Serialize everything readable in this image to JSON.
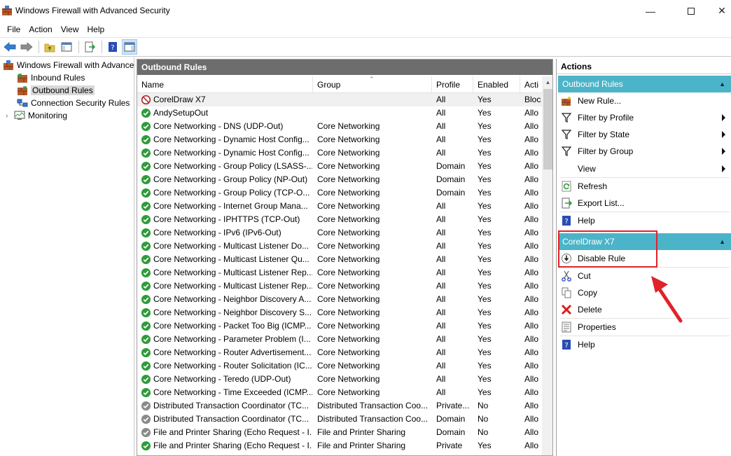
{
  "window": {
    "title": "Windows Firewall with Advanced Security"
  },
  "menubar": [
    "File",
    "Action",
    "View",
    "Help"
  ],
  "tree": [
    {
      "label": "Windows Firewall with Advance",
      "level": 0,
      "selected": false
    },
    {
      "label": "Inbound Rules",
      "level": 1,
      "selected": false
    },
    {
      "label": "Outbound Rules",
      "level": 1,
      "selected": true
    },
    {
      "label": "Connection Security Rules",
      "level": 1,
      "selected": false
    },
    {
      "label": "Monitoring",
      "level": 1,
      "selected": false
    }
  ],
  "center": {
    "title": "Outbound Rules",
    "columns": [
      "Name",
      "Group",
      "Profile",
      "Enabled",
      "Acti"
    ],
    "rows": [
      {
        "name": "CorelDraw X7",
        "group": "",
        "profile": "All",
        "enabled": "Yes",
        "action": "Bloc",
        "status": "block",
        "selected": true
      },
      {
        "name": "AndySetupOut",
        "group": "",
        "profile": "All",
        "enabled": "Yes",
        "action": "Allo",
        "status": "allow"
      },
      {
        "name": "Core Networking - DNS (UDP-Out)",
        "group": "Core Networking",
        "profile": "All",
        "enabled": "Yes",
        "action": "Allo",
        "status": "allow"
      },
      {
        "name": "Core Networking - Dynamic Host Config...",
        "group": "Core Networking",
        "profile": "All",
        "enabled": "Yes",
        "action": "Allo",
        "status": "allow"
      },
      {
        "name": "Core Networking - Dynamic Host Config...",
        "group": "Core Networking",
        "profile": "All",
        "enabled": "Yes",
        "action": "Allo",
        "status": "allow"
      },
      {
        "name": "Core Networking - Group Policy (LSASS-...",
        "group": "Core Networking",
        "profile": "Domain",
        "enabled": "Yes",
        "action": "Allo",
        "status": "allow"
      },
      {
        "name": "Core Networking - Group Policy (NP-Out)",
        "group": "Core Networking",
        "profile": "Domain",
        "enabled": "Yes",
        "action": "Allo",
        "status": "allow"
      },
      {
        "name": "Core Networking - Group Policy (TCP-O...",
        "group": "Core Networking",
        "profile": "Domain",
        "enabled": "Yes",
        "action": "Allo",
        "status": "allow"
      },
      {
        "name": "Core Networking - Internet Group Mana...",
        "group": "Core Networking",
        "profile": "All",
        "enabled": "Yes",
        "action": "Allo",
        "status": "allow"
      },
      {
        "name": "Core Networking - IPHTTPS (TCP-Out)",
        "group": "Core Networking",
        "profile": "All",
        "enabled": "Yes",
        "action": "Allo",
        "status": "allow"
      },
      {
        "name": "Core Networking - IPv6 (IPv6-Out)",
        "group": "Core Networking",
        "profile": "All",
        "enabled": "Yes",
        "action": "Allo",
        "status": "allow"
      },
      {
        "name": "Core Networking - Multicast Listener Do...",
        "group": "Core Networking",
        "profile": "All",
        "enabled": "Yes",
        "action": "Allo",
        "status": "allow"
      },
      {
        "name": "Core Networking - Multicast Listener Qu...",
        "group": "Core Networking",
        "profile": "All",
        "enabled": "Yes",
        "action": "Allo",
        "status": "allow"
      },
      {
        "name": "Core Networking - Multicast Listener Rep...",
        "group": "Core Networking",
        "profile": "All",
        "enabled": "Yes",
        "action": "Allo",
        "status": "allow"
      },
      {
        "name": "Core Networking - Multicast Listener Rep...",
        "group": "Core Networking",
        "profile": "All",
        "enabled": "Yes",
        "action": "Allo",
        "status": "allow"
      },
      {
        "name": "Core Networking - Neighbor Discovery A...",
        "group": "Core Networking",
        "profile": "All",
        "enabled": "Yes",
        "action": "Allo",
        "status": "allow"
      },
      {
        "name": "Core Networking - Neighbor Discovery S...",
        "group": "Core Networking",
        "profile": "All",
        "enabled": "Yes",
        "action": "Allo",
        "status": "allow"
      },
      {
        "name": "Core Networking - Packet Too Big (ICMP...",
        "group": "Core Networking",
        "profile": "All",
        "enabled": "Yes",
        "action": "Allo",
        "status": "allow"
      },
      {
        "name": "Core Networking - Parameter Problem (I...",
        "group": "Core Networking",
        "profile": "All",
        "enabled": "Yes",
        "action": "Allo",
        "status": "allow"
      },
      {
        "name": "Core Networking - Router Advertisement...",
        "group": "Core Networking",
        "profile": "All",
        "enabled": "Yes",
        "action": "Allo",
        "status": "allow"
      },
      {
        "name": "Core Networking - Router Solicitation (IC...",
        "group": "Core Networking",
        "profile": "All",
        "enabled": "Yes",
        "action": "Allo",
        "status": "allow"
      },
      {
        "name": "Core Networking - Teredo (UDP-Out)",
        "group": "Core Networking",
        "profile": "All",
        "enabled": "Yes",
        "action": "Allo",
        "status": "allow"
      },
      {
        "name": "Core Networking - Time Exceeded (ICMP...",
        "group": "Core Networking",
        "profile": "All",
        "enabled": "Yes",
        "action": "Allo",
        "status": "allow"
      },
      {
        "name": "Distributed Transaction Coordinator (TC...",
        "group": "Distributed Transaction Coo...",
        "profile": "Private...",
        "enabled": "No",
        "action": "Allo",
        "status": "disabled"
      },
      {
        "name": "Distributed Transaction Coordinator (TC...",
        "group": "Distributed Transaction Coo...",
        "profile": "Domain",
        "enabled": "No",
        "action": "Allo",
        "status": "disabled"
      },
      {
        "name": "File and Printer Sharing (Echo Request - I...",
        "group": "File and Printer Sharing",
        "profile": "Domain",
        "enabled": "No",
        "action": "Allo",
        "status": "disabled"
      },
      {
        "name": "File and Printer Sharing (Echo Request - I...",
        "group": "File and Printer Sharing",
        "profile": "Private",
        "enabled": "Yes",
        "action": "Allo",
        "status": "allow"
      }
    ]
  },
  "actions": {
    "title": "Actions",
    "section1": {
      "label": "Outbound Rules",
      "items": [
        {
          "label": "New Rule...",
          "icon": "new-rule-icon",
          "submenu": false
        },
        {
          "label": "Filter by Profile",
          "icon": "filter-icon",
          "submenu": true
        },
        {
          "label": "Filter by State",
          "icon": "filter-icon",
          "submenu": true
        },
        {
          "label": "Filter by Group",
          "icon": "filter-icon",
          "submenu": true
        },
        {
          "label": "View",
          "icon": "",
          "submenu": true
        },
        {
          "label": "Refresh",
          "icon": "refresh-icon",
          "submenu": false
        },
        {
          "label": "Export List...",
          "icon": "export-icon",
          "submenu": false
        },
        {
          "label": "Help",
          "icon": "help-icon",
          "submenu": false
        }
      ]
    },
    "section2": {
      "label": "CorelDraw X7",
      "items": [
        {
          "label": "Disable Rule",
          "icon": "disable-rule-icon"
        },
        {
          "label": "Cut",
          "icon": "cut-icon"
        },
        {
          "label": "Copy",
          "icon": "copy-icon"
        },
        {
          "label": "Delete",
          "icon": "delete-icon"
        },
        {
          "label": "Properties",
          "icon": "properties-icon"
        },
        {
          "label": "Help",
          "icon": "help-icon"
        }
      ]
    }
  },
  "colors": {
    "section_header": "#4cb4c8",
    "pane_header": "#6d6d6d",
    "highlight": "#e0222a",
    "allow_green": "#2e9c3a"
  }
}
